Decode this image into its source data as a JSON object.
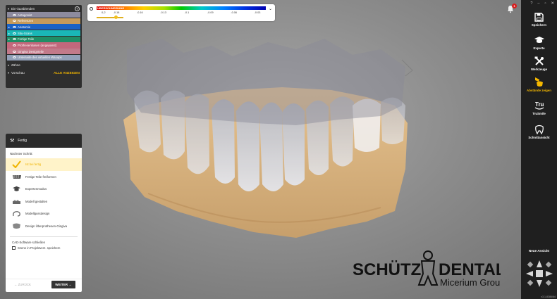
{
  "visibility": {
    "title": "Ein-/ausblenden",
    "help": "?",
    "items": [
      {
        "label": "Antagonist",
        "color": "#8d8b9e",
        "arrow": ""
      },
      {
        "label": "Referenzen",
        "color": "#c59a5a",
        "arrow": ""
      },
      {
        "label": "Anatomie",
        "color": "#1a62c5",
        "arrow": "▸"
      },
      {
        "label": "Situ-Scans",
        "color": "#1ab7b7",
        "arrow": "▸"
      },
      {
        "label": "Fertige Teile",
        "color": "#1f8e66",
        "arrow": "▸"
      },
      {
        "label": "Prothesenbasen (angepasst)",
        "color": "#c2687c",
        "arrow": ""
      },
      {
        "label": "Gingiva Designteile",
        "color": "#c27a8a",
        "arrow": ""
      },
      {
        "label": "Unterseite des virtuellen Waxups",
        "color": "#92a0b8",
        "arrow": ""
      }
    ],
    "teeth_label": "Zähne",
    "preview_label": "Vorschau",
    "show_all": "ALLE ANZEIGEN"
  },
  "distance_bar": {
    "overlap_label": "ÜBERSCHNEIDUNG",
    "first_value": "0,2",
    "ticks": [
      "-0.18",
      "-0.16",
      "-0.13",
      "-0.1",
      "-0.09",
      "-0.06",
      "-0.03"
    ]
  },
  "notifications": {
    "count": "1"
  },
  "window_controls": [
    "?",
    "–",
    "▫",
    "✕"
  ],
  "toolbar": {
    "save": "Speichern",
    "expert": "Experte",
    "tools": "Werkzeuge",
    "show_distances": "Abstände zeigen",
    "trusmile": "TruSmile",
    "section": "Schnittansicht",
    "new_view": "Neue Ansicht",
    "version": "v3.1.8386/64",
    "active_color": "#f5b800"
  },
  "workflow": {
    "title": "Fertig",
    "next_step": "Nächster Schritt:",
    "steps": [
      {
        "label": "Ist bei fertig",
        "active": true
      },
      {
        "label": "Fertige Teile freiformen",
        "active": false
      },
      {
        "label": "Expertenmodus",
        "active": false
      },
      {
        "label": "Modell gestalten",
        "active": false
      },
      {
        "label": "Modellgussdesign",
        "active": false
      },
      {
        "label": "Design Überprothesen-Gingiva",
        "active": false
      }
    ],
    "close_cad": "CAD-Software schließen",
    "save_checkbox": "Szene in Projektverz. speichern",
    "back": "ZURÜCK",
    "forward": "WEITER"
  },
  "logo": {
    "brand": "SCHÜTZ",
    "brand2": "DENTAL",
    "sub": "Micerium Group"
  }
}
